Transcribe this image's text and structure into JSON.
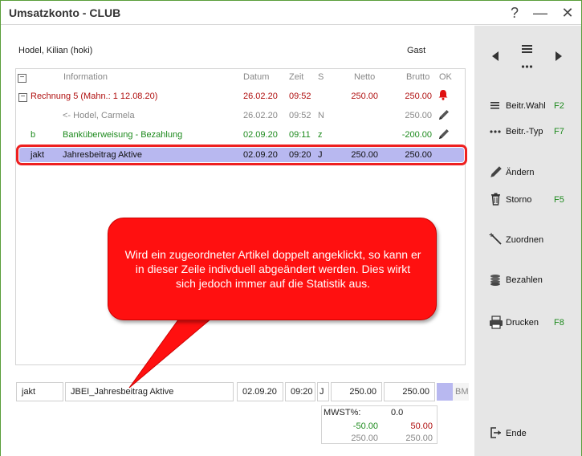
{
  "window": {
    "title": "Umsatzkonto - CLUB",
    "help": "?",
    "minimize": "—",
    "close": "✕"
  },
  "member": {
    "name": "Hodel, Kilian (hoki)",
    "status": "Gast"
  },
  "columns": {
    "information": "Information",
    "datum": "Datum",
    "zeit": "Zeit",
    "s": "S",
    "netto": "Netto",
    "brutto": "Brutto",
    "ok": "OK"
  },
  "rows": [
    {
      "code": "",
      "info": "Rechnung 5 (Mahn.: 1 12.08.20)",
      "datum": "26.02.20",
      "zeit": "09:52",
      "s": "",
      "netto": "250.00",
      "brutto": "250.00"
    },
    {
      "code": "",
      "info": "<- Hodel, Carmela",
      "datum": "26.02.20",
      "zeit": "09:52",
      "s": "N",
      "netto": "",
      "brutto": "250.00"
    },
    {
      "code": "b",
      "info": "Banküberweisung - Bezahlung",
      "datum": "02.09.20",
      "zeit": "09:11",
      "s": "z",
      "netto": "",
      "brutto": "-200.00"
    },
    {
      "code": "jakt",
      "info": "Jahresbeitrag Aktive",
      "datum": "02.09.20",
      "zeit": "09:20",
      "s": "J",
      "netto": "250.00",
      "brutto": "250.00"
    }
  ],
  "callout": {
    "text": "Wird ein zugeordneter Artikel doppelt angeklickt, so kann er in dieser Zeile indivduell abgeändert werden. Dies wirkt sich jedoch immer auf die Statistik aus."
  },
  "edit": {
    "code": "jakt",
    "info": "JBEI_Jahresbeitrag Aktive",
    "datum": "02.09.20",
    "zeit": "09:20",
    "s": "J",
    "netto": "250.00",
    "brutto": "250.00",
    "bm": "BM"
  },
  "mwst": {
    "label": "MWST%:",
    "rate": "0.0",
    "left_green": "-50.00",
    "right_red": "50.00",
    "left_gray": "250.00",
    "right_gray": "250.00"
  },
  "sidebar": {
    "beitr_wahl": "Beitr.Wahl",
    "beitr_wahl_key": "F2",
    "beitr_typ": "Beitr.-Typ",
    "beitr_typ_key": "F7",
    "aendern": "Ändern",
    "storno": "Storno",
    "storno_key": "F5",
    "zuordnen": "Zuordnen",
    "bezahlen": "Bezahlen",
    "drucken": "Drucken",
    "drucken_key": "F8",
    "ende": "Ende"
  },
  "colors": {
    "accent_green": "#1d8a1d",
    "alert_red": "#b01010",
    "selection": "#b8b8f0",
    "callout": "#ff1010"
  }
}
